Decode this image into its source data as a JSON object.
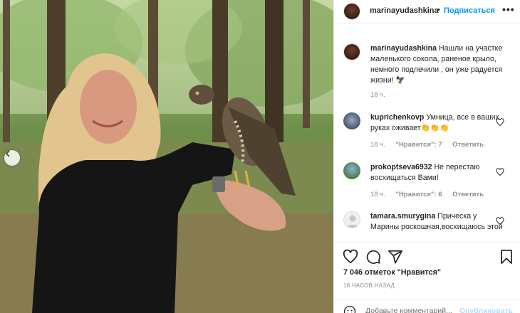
{
  "post": {
    "image_alt": "",
    "nav_prev_icon": "chevron-left-icon"
  },
  "header": {
    "username": "marinayudashkina",
    "separator": "•",
    "follow_label": "Подписаться",
    "more_label": "•••"
  },
  "caption": {
    "username": "marinayudashkina",
    "text": "Нашли на участке маленького сокола, раненое крыло, немного подлечили , он уже радуется жизни! 🦅",
    "time": "18 ч."
  },
  "comments": [
    {
      "username": "kuprichenkovp",
      "text": "Умница, все в ваших руках оживает👏👏👏",
      "time": "18 ч.",
      "likes": "\"Нравится\": 7",
      "reply": "Ответить"
    },
    {
      "username": "prokoptseva6932",
      "text": "Не перестаю восхищаться Вами!",
      "time": "18 ч.",
      "likes": "\"Нравится\": 6",
      "reply": "Ответить"
    },
    {
      "username": "tamara.smurygina",
      "text": "Прическа у Марины роскошная,восхищаюсь этой",
      "time": "",
      "likes": "",
      "reply": ""
    }
  ],
  "actions": {
    "like_icon": "heart-icon",
    "comment_icon": "comment-icon",
    "share_icon": "paper-plane-icon",
    "save_icon": "bookmark-icon"
  },
  "stats": {
    "likes": "7 046 отметок \"Нравится\"",
    "time_ago": "18 ЧАСОВ НАЗАД"
  },
  "add_comment": {
    "placeholder": "Добавьте комментарий...",
    "publish_label": "Опубликовать"
  },
  "colors": {
    "accent": "#0095f6",
    "text": "#262626",
    "muted": "#8e8e8e",
    "border": "#efefef"
  }
}
